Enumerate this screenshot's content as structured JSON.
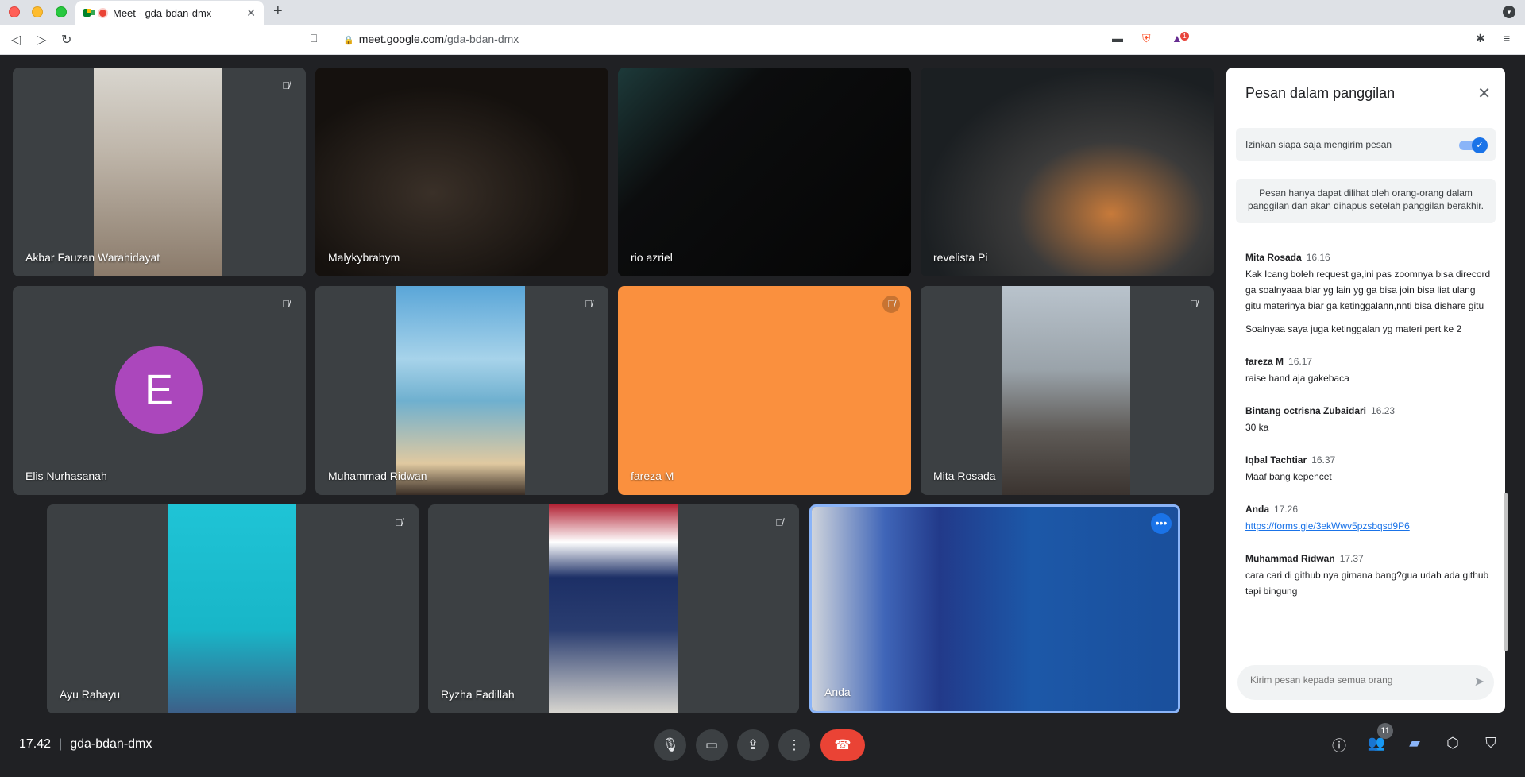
{
  "browser": {
    "tab_title": "Meet - gda-bdan-dmx",
    "tab_close": "✕",
    "new_tab": "+",
    "url_host": "meet.google.com",
    "url_path": "/gda-bdan-dmx",
    "extension_badge": "1"
  },
  "participants": [
    {
      "name": "Akbar Fauzan Warahidayat",
      "muted": true
    },
    {
      "name": "Malykybrahym",
      "muted": false
    },
    {
      "name": "rio azriel",
      "muted": false
    },
    {
      "name": "revelista Pi",
      "muted": false
    },
    {
      "name": "Elis Nurhasanah",
      "muted": true,
      "avatar_letter": "E"
    },
    {
      "name": "Muhammad Ridwan",
      "muted": true
    },
    {
      "name": "fareza M",
      "muted": true
    },
    {
      "name": "Mita Rosada",
      "muted": true
    },
    {
      "name": "Ayu Rahayu",
      "muted": true
    },
    {
      "name": "Ryzha Fadillah",
      "muted": true
    },
    {
      "name": "Anda",
      "muted": false
    }
  ],
  "meeting": {
    "time": "17.42",
    "separator": "|",
    "code": "gda-bdan-dmx",
    "participant_count": "11"
  },
  "chat": {
    "title": "Pesan dalam panggilan",
    "toggle_label": "Izinkan siapa saja mengirim pesan",
    "toggle_on": true,
    "info": "Pesan hanya dapat dilihat oleh orang-orang dalam panggilan dan akan dihapus setelah panggilan berakhir.",
    "messages": [
      {
        "sender": "Mita Rosada",
        "time": "16.16",
        "text": "Kak Icang boleh request ga,ini pas zoomnya bisa direcord ga soalnyaaa biar yg lain yg ga bisa join bisa liat ulang gitu materinya biar ga ketinggalann,nnti bisa dishare gitu",
        "text2": "Soalnyaa saya juga ketinggalan yg materi pert ke 2"
      },
      {
        "sender": "fareza M",
        "time": "16.17",
        "text": "raise hand aja gakebaca"
      },
      {
        "sender": "Bintang octrisna Zubaidari",
        "time": "16.23",
        "text": "30 ka"
      },
      {
        "sender": "Iqbal Tachtiar",
        "time": "16.37",
        "text": "Maaf bang kepencet"
      },
      {
        "sender": "Anda",
        "time": "17.26",
        "link": "https://forms.gle/3ekWwv5pzsbqsd9P6"
      },
      {
        "sender": "Muhammad Ridwan",
        "time": "17.37",
        "text": "cara cari di github nya gimana bang?gua udah ada github tapi bingung"
      }
    ],
    "input_placeholder": "Kirim pesan kepada semua orang"
  },
  "colors": {
    "background": "#202124",
    "tile": "#3c4043",
    "orange_tile": "#fa903e",
    "avatar": "#ab47bc",
    "end_call": "#ea4335",
    "accent": "#1a73e8"
  },
  "icons": {
    "mic_off": "mic-off-icon",
    "more": "more-options-icon"
  }
}
